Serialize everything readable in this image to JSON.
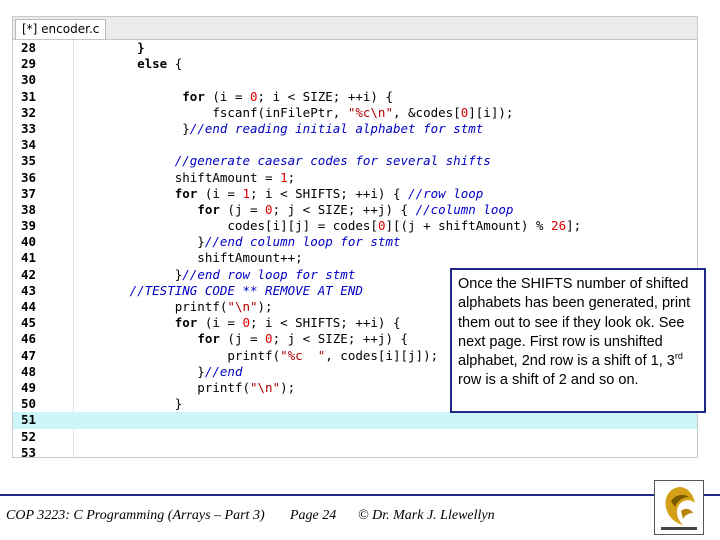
{
  "editor": {
    "tab_title": "[*] encoder.c",
    "lines": [
      {
        "n": "28",
        "parts": [
          [
            "",
            "    "
          ],
          [
            "kw",
            "}"
          ]
        ]
      },
      {
        "n": "29",
        "parts": [
          [
            "",
            "    "
          ],
          [
            "kw",
            "else"
          ],
          [
            "",
            " {"
          ]
        ]
      },
      {
        "n": "30",
        "parts": []
      },
      {
        "n": "31",
        "parts": [
          [
            "",
            "          "
          ],
          [
            "kw",
            "for"
          ],
          [
            "",
            " (i = "
          ],
          [
            "nm",
            "0"
          ],
          [
            "",
            "; i < SIZE; ++i) {"
          ]
        ]
      },
      {
        "n": "32",
        "parts": [
          [
            "",
            "              fscanf(inFilePtr, "
          ],
          [
            "st",
            "\"%c\\n\""
          ],
          [
            "",
            ", &codes["
          ],
          [
            "nm",
            "0"
          ],
          [
            "",
            "][i]);"
          ]
        ]
      },
      {
        "n": "33",
        "parts": [
          [
            "",
            "          }"
          ],
          [
            "cm",
            "//end reading initial alphabet for stmt"
          ]
        ]
      },
      {
        "n": "34",
        "parts": []
      },
      {
        "n": "35",
        "parts": [
          [
            "",
            "         "
          ],
          [
            "cm",
            "//generate caesar codes for several shifts"
          ]
        ]
      },
      {
        "n": "36",
        "parts": [
          [
            "",
            "         shiftAmount = "
          ],
          [
            "nm",
            "1"
          ],
          [
            "",
            ";"
          ]
        ]
      },
      {
        "n": "37",
        "parts": [
          [
            "",
            "         "
          ],
          [
            "kw",
            "for"
          ],
          [
            "",
            " (i = "
          ],
          [
            "nm",
            "1"
          ],
          [
            "",
            "; i < SHIFTS; ++i) { "
          ],
          [
            "cm",
            "//row loop"
          ]
        ]
      },
      {
        "n": "38",
        "parts": [
          [
            "",
            "            "
          ],
          [
            "kw",
            "for"
          ],
          [
            "",
            " (j = "
          ],
          [
            "nm",
            "0"
          ],
          [
            "",
            "; j < SIZE; ++j) { "
          ],
          [
            "cm",
            "//column loop"
          ]
        ]
      },
      {
        "n": "39",
        "parts": [
          [
            "",
            "                codes[i][j] = codes["
          ],
          [
            "nm",
            "0"
          ],
          [
            "",
            "][(j + shiftAmount) % "
          ],
          [
            "nm",
            "26"
          ],
          [
            "",
            "];"
          ]
        ]
      },
      {
        "n": "40",
        "parts": [
          [
            "",
            "            }"
          ],
          [
            "cm",
            "//end column loop for stmt"
          ]
        ]
      },
      {
        "n": "41",
        "parts": [
          [
            "",
            "            shiftAmount++;"
          ]
        ]
      },
      {
        "n": "42",
        "parts": [
          [
            "",
            "         }"
          ],
          [
            "cm",
            "//end row loop for stmt"
          ]
        ]
      },
      {
        "n": "43",
        "parts": [
          [
            "",
            "   "
          ],
          [
            "cm",
            "//TESTING CODE ** REMOVE AT END"
          ]
        ]
      },
      {
        "n": "44",
        "parts": [
          [
            "",
            "         printf("
          ],
          [
            "st",
            "\"\\n\""
          ],
          [
            "",
            ");"
          ]
        ]
      },
      {
        "n": "45",
        "parts": [
          [
            "",
            "         "
          ],
          [
            "kw",
            "for"
          ],
          [
            "",
            " (i = "
          ],
          [
            "nm",
            "0"
          ],
          [
            "",
            "; i < SHIFTS; ++i) {"
          ]
        ]
      },
      {
        "n": "46",
        "parts": [
          [
            "",
            "            "
          ],
          [
            "kw",
            "for"
          ],
          [
            "",
            " (j = "
          ],
          [
            "nm",
            "0"
          ],
          [
            "",
            "; j < SIZE; ++j) {"
          ]
        ]
      },
      {
        "n": "47",
        "parts": [
          [
            "",
            "                printf("
          ],
          [
            "st",
            "\"%c  \""
          ],
          [
            "",
            ", codes[i][j]);"
          ]
        ]
      },
      {
        "n": "48",
        "parts": [
          [
            "",
            "            }"
          ],
          [
            "cm",
            "//end"
          ]
        ]
      },
      {
        "n": "49",
        "parts": [
          [
            "",
            "            printf("
          ],
          [
            "st",
            "\"\\n\""
          ],
          [
            "",
            ");"
          ]
        ]
      },
      {
        "n": "50",
        "parts": [
          [
            "",
            "         }"
          ]
        ]
      },
      {
        "n": "51",
        "parts": [],
        "active": true
      },
      {
        "n": "52",
        "parts": []
      },
      {
        "n": "53",
        "parts": []
      }
    ]
  },
  "callout": {
    "pre": "Once the SHIFTS number of shifted alphabets has been generated, print them out to see if they look ok. See next page.  First row is unshifted alphabet, 2nd row is a shift of 1, 3",
    "sup": "rd",
    "post": " row is a shift of 2 and so on."
  },
  "footer": {
    "course": "COP 3223: C Programming (Arrays – Part 3)",
    "page": "Page 24",
    "author": "© Dr. Mark J. Llewellyn"
  },
  "colors": {
    "accent": "#1f2a88",
    "comment": "#0000c8",
    "string": "#b00000",
    "number": "#e00000",
    "active_line": "#cdf6fb"
  },
  "icons": {
    "logo": "university-pegasus-logo"
  }
}
